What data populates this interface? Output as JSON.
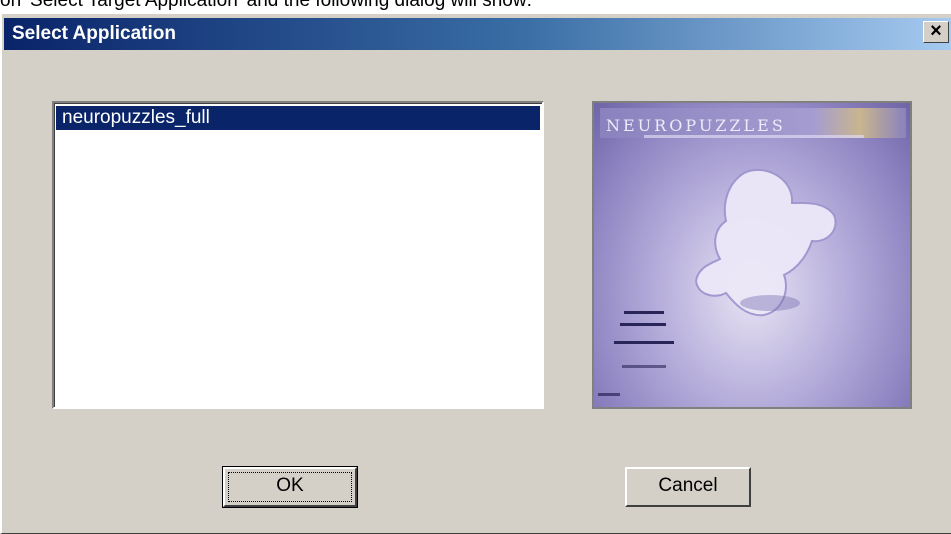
{
  "page": {
    "caption": "on 'Select Target Application' and the following dialog will show:"
  },
  "dialog": {
    "title": "Select Application",
    "close_label": "×"
  },
  "listbox": {
    "items": [
      "neuropuzzles_full"
    ],
    "selected_index": 0
  },
  "preview": {
    "logo_text": "NEUROPUZZLES"
  },
  "buttons": {
    "ok_label": "OK",
    "cancel_label": "Cancel"
  },
  "colors": {
    "titlebar_start": "#0a246a",
    "titlebar_end": "#a6caf0",
    "dialog_face": "#d4d0c8",
    "selection": "#0a246a"
  }
}
